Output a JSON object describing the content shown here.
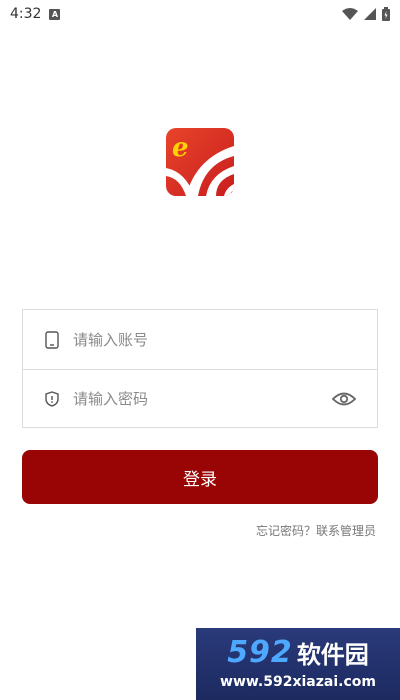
{
  "status_bar": {
    "time": "4:32",
    "notification_letter": "A",
    "icons": [
      "wifi-icon",
      "signal-icon",
      "battery-icon"
    ]
  },
  "logo": {
    "letter": "e",
    "icon": "app-logo-icon"
  },
  "form": {
    "account": {
      "placeholder": "请输入账号",
      "value": "",
      "icon": "phone-icon"
    },
    "password": {
      "placeholder": "请输入密码",
      "value": "",
      "icon": "shield-icon",
      "toggle_icon": "eye-icon"
    }
  },
  "login_button": {
    "label": "登录"
  },
  "forgot_link": {
    "label": "忘记密码？联系管理员"
  },
  "watermark": {
    "brand_number": "592",
    "brand_text": "软件园",
    "url": "www.592xiazai.com"
  },
  "colors": {
    "primary": "#990505",
    "border": "#dcdcdc",
    "placeholder": "#8a8a8a",
    "link": "#777777"
  }
}
